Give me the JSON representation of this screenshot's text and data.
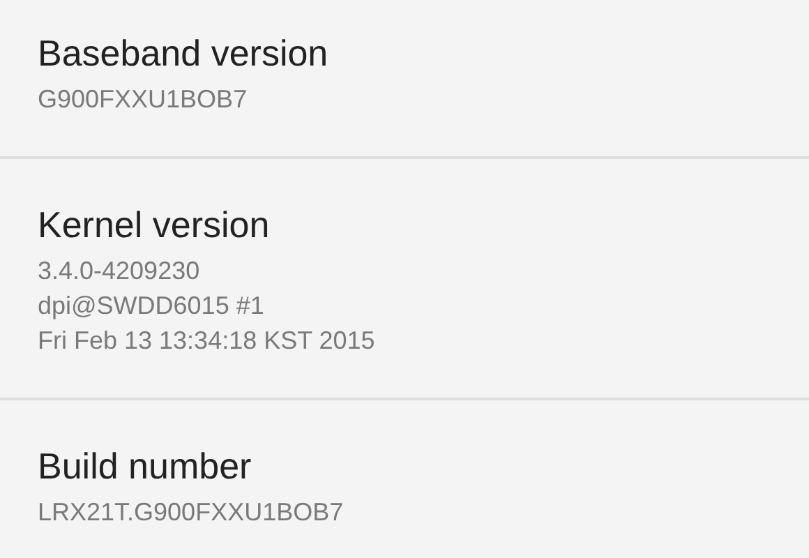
{
  "items": [
    {
      "title": "Baseband version",
      "lines": [
        "G900FXXU1BOB7"
      ]
    },
    {
      "title": "Kernel version",
      "lines": [
        "3.4.0-4209230",
        "dpi@SWDD6015 #1",
        "Fri Feb 13 13:34:18 KST 2015"
      ]
    },
    {
      "title": "Build number",
      "lines": [
        "LRX21T.G900FXXU1BOB7"
      ]
    }
  ]
}
